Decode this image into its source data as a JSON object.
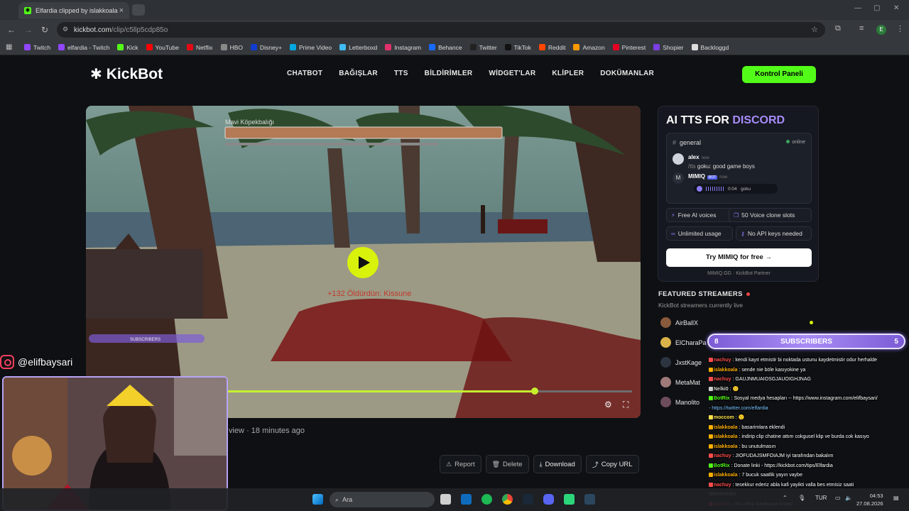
{
  "browser": {
    "tab_title": "Elfardia clipped by islakkoala",
    "url_host": "kickbot.com",
    "url_path": "/clip/c5llp5cdp85o",
    "profile_initial": "E"
  },
  "bookmarks": [
    {
      "label": "Twitch",
      "color": "#9146ff"
    },
    {
      "label": "elfardia - Twitch",
      "color": "#9146ff"
    },
    {
      "label": "Kick",
      "color": "#53fc18"
    },
    {
      "label": "YouTube",
      "color": "#ff0000"
    },
    {
      "label": "Netflix",
      "color": "#e50914"
    },
    {
      "label": "HBO",
      "color": "#888888"
    },
    {
      "label": "Disney+",
      "color": "#113ccf"
    },
    {
      "label": "Prime Video",
      "color": "#00a8e1"
    },
    {
      "label": "Letterboxd",
      "color": "#40bcf4"
    },
    {
      "label": "Instagram",
      "color": "#e1306c"
    },
    {
      "label": "Behance",
      "color": "#1769ff"
    },
    {
      "label": "Twitter",
      "color": "#222222"
    },
    {
      "label": "TikTok",
      "color": "#111111"
    },
    {
      "label": "Reddit",
      "color": "#ff4500"
    },
    {
      "label": "Amazon",
      "color": "#ff9900"
    },
    {
      "label": "Pinterest",
      "color": "#e60023"
    },
    {
      "label": "Shopier",
      "color": "#7b3fe4"
    },
    {
      "label": "Backloggd",
      "color": "#dddddd"
    }
  ],
  "site": {
    "logo": "KickBot",
    "nav": [
      "CHATBOT",
      "BAĞIŞLAR",
      "TTS",
      "BİLDİRİMLER",
      "WİDGET'LAR",
      "KLİPLER",
      "DOKÜMANLAR"
    ],
    "control_panel": "Kontrol Paneli",
    "accent": "#53fc18"
  },
  "clip": {
    "progress_fraction": 0.76,
    "views": "view",
    "time_ago": "18 minutes ago",
    "actions": [
      "Report",
      "Delete",
      "Download",
      "Copy URL"
    ],
    "overlay_bar_label": "Mavi Köpekbalığı",
    "overlay_text": "+132 Öldürdün: Kissune",
    "overlay_subs": "SUBSCRIBERS"
  },
  "promo": {
    "title_a": "AI TTS FOR ",
    "title_b": "DISCORD",
    "channel": "general",
    "online": "online",
    "msg1_user": "alex",
    "msg1_time": "now",
    "msg1_cmd": "/tts",
    "msg1_text": "goku: good game boys",
    "msg2_user": "MIMIQ",
    "msg2_badge": "BOT",
    "msg2_time": "now",
    "audio_time": "0:04",
    "audio_voice": "goku",
    "chips": [
      "Free AI voices",
      "50 Voice clone slots",
      "Unlimited usage",
      "No API keys needed"
    ],
    "cta": "Try MIMIQ for free →",
    "partner": "MIMIQ.GG · KickBot Partner"
  },
  "featured": {
    "title": "FEATURED STREAMERS",
    "subtitle": "KickBot streamers currently live",
    "streamers": [
      "AirBallX",
      "ElCharaPa",
      "JxstKage",
      "MetaMat",
      "Manolito"
    ]
  },
  "stream_overlay": {
    "instagram_handle": "@elifbaysari",
    "subs_left": "8",
    "subs_label": "SUBSCRIBERS",
    "subs_right": "5"
  },
  "chat": [
    {
      "user": "nachuy",
      "ucolor": "#ff4d4d",
      "text": "kendi kayıt etmistir bi noktada ustunu kaydetmistir odur herhalde"
    },
    {
      "user": "islakkoala",
      "ucolor": "#ffb000",
      "text": "sende nie böle kasıyokine ya"
    },
    {
      "user": "nachuy",
      "ucolor": "#ff4d4d",
      "text": "GAUJNMUAIOSGJAUOIGHJNAG"
    },
    {
      "user": "Nelki0",
      "ucolor": "#cfcfcf",
      "text": "🙂"
    },
    {
      "user": "BotRix",
      "ucolor": "#53fc18",
      "text": "Sosyal medya hesapları -- https://www.instagram.com/elifbaysari/"
    },
    {
      "user": "",
      "ucolor": "#7cc4ff",
      "text": "- https://twitter.com/elfardia"
    },
    {
      "user": "moccom",
      "ucolor": "#ffe14d",
      "text": "🙂"
    },
    {
      "user": "islakkoala",
      "ucolor": "#ffb000",
      "text": "basarimlara eklendi"
    },
    {
      "user": "islakkoala",
      "ucolor": "#ffb000",
      "text": "indirip clip chatine attım cokgusel klip ve burda cok kasıyo"
    },
    {
      "user": "islakkoala",
      "ucolor": "#ffb000",
      "text": "bu unutulmasın"
    },
    {
      "user": "nachuy",
      "ucolor": "#ff4d4d",
      "text": "JIOFUDAJSMFOIAJM iyi tarafından bakalım"
    },
    {
      "user": "BotRix",
      "ucolor": "#53fc18",
      "text": "Donate linki - https://kickbot.com/tips/Elfardia"
    },
    {
      "user": "islakkoala",
      "ucolor": "#ffb000",
      "text": "7 bucuk saatlik yayın vaybe"
    },
    {
      "user": "nachuy",
      "ucolor": "#ff4d4d",
      "text": "tesekkur ederiz abla kafi yayikti valla bes etmisiz saati"
    },
    {
      "user": "",
      "ucolor": "#ffffff",
      "text": "farketmedim"
    },
    {
      "user": "nachuy",
      "ucolor": "#ff4d4d",
      "text": "fisi cekip bayilmaca burasi"
    }
  ],
  "taskbar": {
    "search": "Ara",
    "lang": "TUR",
    "time": "04:53",
    "date": "27.08.2026"
  }
}
